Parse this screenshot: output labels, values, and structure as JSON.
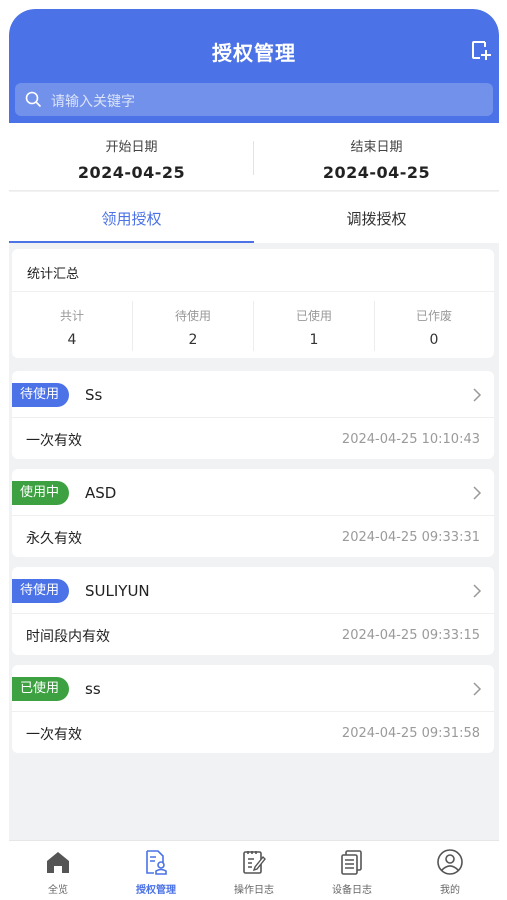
{
  "header": {
    "title": "授权管理",
    "search_placeholder": "请输入关键字"
  },
  "dates": {
    "start_label": "开始日期",
    "start_value": "2024-04-25",
    "end_label": "结束日期",
    "end_value": "2024-04-25"
  },
  "tabs": [
    {
      "label": "领用授权",
      "active": true
    },
    {
      "label": "调拨授权",
      "active": false
    }
  ],
  "stats": {
    "title": "统计汇总",
    "items": [
      {
        "label": "共计",
        "value": "4"
      },
      {
        "label": "待使用",
        "value": "2"
      },
      {
        "label": "已使用",
        "value": "1"
      },
      {
        "label": "已作废",
        "value": "0"
      }
    ]
  },
  "records": [
    {
      "status": "待使用",
      "status_color": "#4b72e6",
      "name": "Ss",
      "type": "一次有效",
      "time": "2024-04-25 10:10:43"
    },
    {
      "status": "使用中",
      "status_color": "#3ea141",
      "name": "ASD",
      "type": "永久有效",
      "time": "2024-04-25 09:33:31"
    },
    {
      "status": "待使用",
      "status_color": "#4b72e6",
      "name": "SULIYUN",
      "type": "时间段内有效",
      "time": "2024-04-25 09:33:15"
    },
    {
      "status": "已使用",
      "status_color": "#3ea141",
      "name": "ss",
      "type": "一次有效",
      "time": "2024-04-25 09:31:58"
    }
  ],
  "tabbar": [
    {
      "label": "全览",
      "icon": "home-icon",
      "active": false
    },
    {
      "label": "授权管理",
      "icon": "authorization-icon",
      "active": true
    },
    {
      "label": "操作日志",
      "icon": "operation-log-icon",
      "active": false
    },
    {
      "label": "设备日志",
      "icon": "device-log-icon",
      "active": false
    },
    {
      "label": "我的",
      "icon": "profile-icon",
      "active": false
    }
  ],
  "colors": {
    "primary": "#4b72e6",
    "success": "#3ea141",
    "background": "#f1f2f4"
  }
}
